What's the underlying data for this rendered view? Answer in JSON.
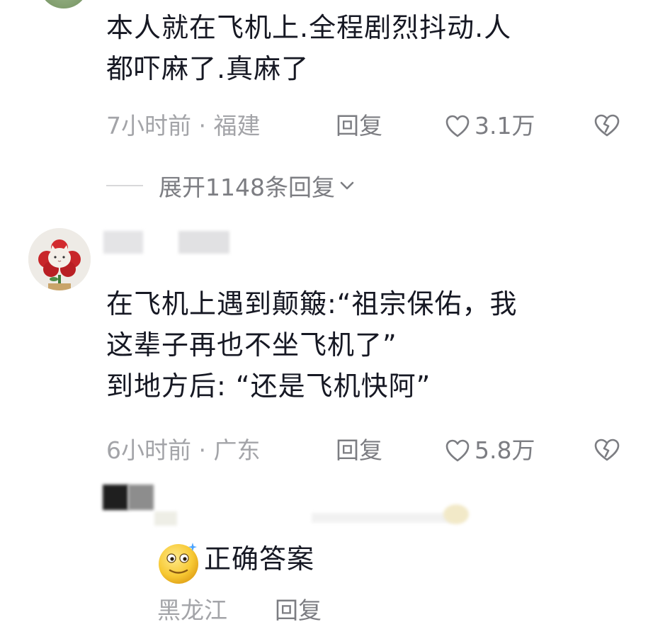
{
  "comments": [
    {
      "text_lines": [
        "本人就在飞机上.全程剧烈抖动.人",
        "都吓麻了.真麻了"
      ],
      "time": "7小时前 · 福建",
      "reply_label": "回复",
      "likes": "3.1万",
      "expand_label": "展开1148条回复"
    },
    {
      "text_lines": [
        "在飞机上遇到颠簸:“祖宗保佑，我",
        "这辈子再也不坐飞机了”",
        "到地方后: “还是飞机快阿”"
      ],
      "time": "6小时前 · 广东",
      "reply_label": "回复",
      "likes": "5.8万"
    }
  ],
  "sub_reply": {
    "text": "正确答案",
    "location": "黑龙江",
    "reply_label": "回复"
  },
  "colors": {
    "text": "#161823",
    "meta": "#a3a4a8",
    "action": "#7c7d82"
  },
  "icons": [
    "heart-outline-icon",
    "broken-heart-icon",
    "chevron-down-icon",
    "smiling-face-emoji-icon"
  ]
}
